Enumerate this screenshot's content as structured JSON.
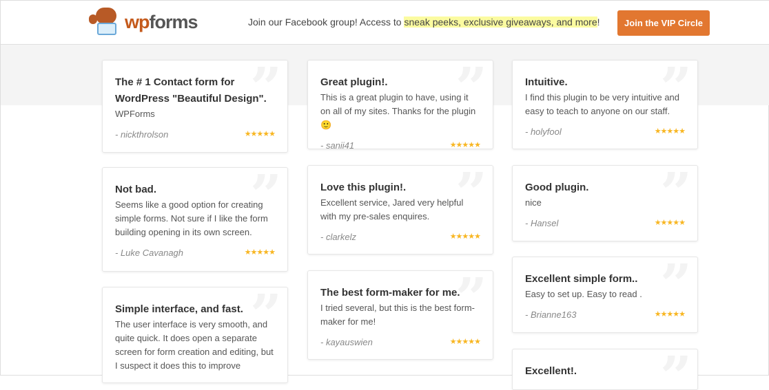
{
  "header": {
    "logo_text_wp": "wp",
    "logo_text_forms": "forms",
    "promo_prefix": "Join our Facebook group! Access to ",
    "promo_highlight": "sneak peeks, exclusive giveaways, and more",
    "promo_suffix": "!",
    "vip_button": "Join the VIP Circle"
  },
  "colors": {
    "accent": "#e27730",
    "stars": "#f8b622",
    "highlight": "#fbfba0"
  },
  "reviews": [
    {
      "title": "The # 1 Contact form for WordPress \"Beautiful Design\".",
      "text": "WPForms",
      "author": "- nickthrolson",
      "stars": "★★★★★",
      "rating": 5
    },
    {
      "title": "Not bad.",
      "text": "Seems like a good option for creating simple forms. Not sure if I like the form building opening in its own screen.",
      "author": "- Luke Cavanagh",
      "stars": "★★★★★",
      "rating": 5
    },
    {
      "title": "Simple interface, and fast.",
      "text": "The user interface is very smooth, and quite quick. It does open a separate screen for form creation and editing, but I suspect it does this to improve",
      "author": "",
      "stars": "",
      "rating": null
    },
    {
      "title": "Great plugin!.",
      "text": "This is a great plugin to have, using it on all of my sites. Thanks for the plugin 🙂",
      "author": "- sanji41",
      "stars": "★★★★★",
      "rating": 5
    },
    {
      "title": "Love this plugin!.",
      "text": "Excellent service, Jared very helpful with my pre-sales enquires.",
      "author": "- clarkelz",
      "stars": "★★★★★",
      "rating": 5
    },
    {
      "title": "The best form-maker for me.",
      "text": "I tried several, but this is the best form-maker for me!",
      "author": "- kayauswien",
      "stars": "★★★★★",
      "rating": 5
    },
    {
      "title": "Intuitive.",
      "text": "I find this plugin to be very intuitive and easy to teach to anyone on our staff.",
      "author": "- holyfool",
      "stars": "★★★★★",
      "rating": 5
    },
    {
      "title": "Good plugin.",
      "text": "nice",
      "author": "- Hansel",
      "stars": "★★★★★",
      "rating": 5
    },
    {
      "title": "Excellent simple form..",
      "text": "Easy to set up. Easy to read .",
      "author": "- Brianne163",
      "stars": "★★★★★",
      "rating": 5
    },
    {
      "title": "Excellent!.",
      "text": "",
      "author": "",
      "stars": "",
      "rating": null
    }
  ]
}
